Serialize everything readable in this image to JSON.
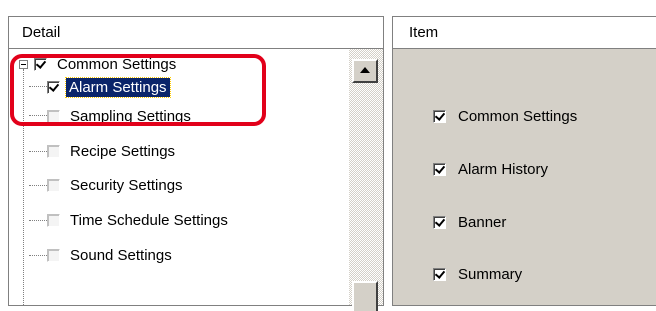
{
  "detail_panel": {
    "header": "Detail",
    "tree": [
      {
        "label": "Common Settings",
        "checked": true,
        "expander": true
      },
      {
        "label": "Alarm Settings",
        "checked": true,
        "selected": true
      },
      {
        "label": "Sampling Settings",
        "checked": false
      },
      {
        "label": "Recipe Settings",
        "checked": false
      },
      {
        "label": "Security Settings",
        "checked": false
      },
      {
        "label": "Time Schedule Settings",
        "checked": false
      },
      {
        "label": "Sound Settings",
        "checked": false
      }
    ]
  },
  "item_panel": {
    "header": "Item",
    "items": [
      {
        "label": "Common Settings",
        "checked": true
      },
      {
        "label": "Alarm History",
        "checked": true
      },
      {
        "label": "Banner",
        "checked": true
      },
      {
        "label": "Summary",
        "checked": true
      }
    ]
  },
  "colors": {
    "highlight": "#e2001a",
    "selection": "#0a246a",
    "panel_bg": "#d4d0c8"
  }
}
